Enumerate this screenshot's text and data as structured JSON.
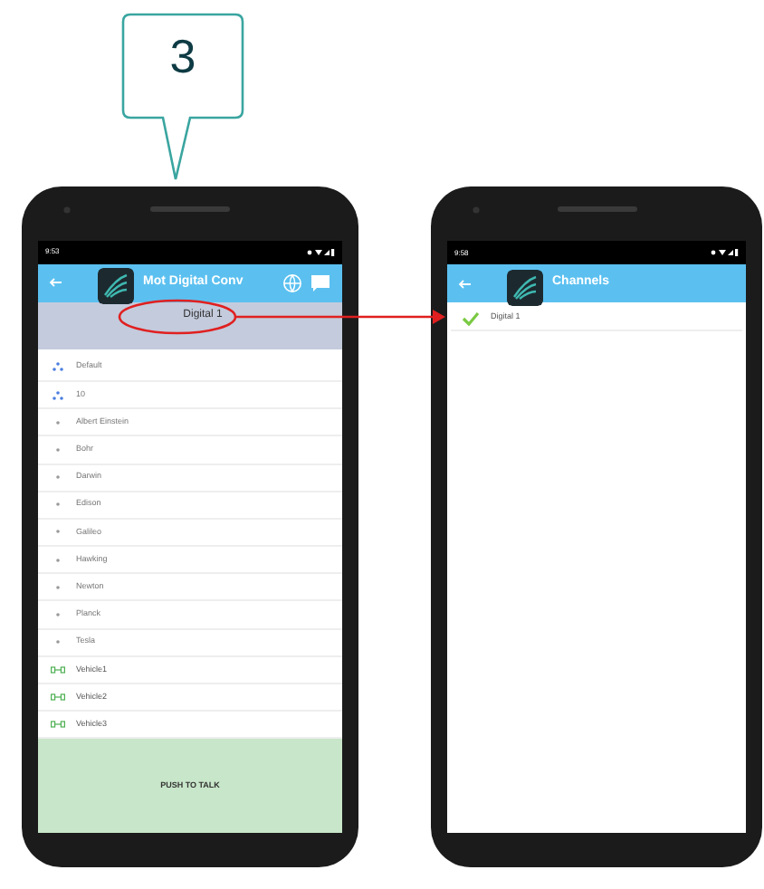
{
  "callout": {
    "label": "3"
  },
  "phones": [
    {
      "kind": "talkgroups",
      "time": "9:53",
      "title": "Mot Digital Conv",
      "selected_channel": "Digital 1",
      "items": [
        {
          "kind": "group",
          "label": "Default"
        },
        {
          "kind": "group",
          "label": "10"
        },
        {
          "kind": "contact",
          "label": "Albert Einstein"
        },
        {
          "kind": "contact",
          "label": "Bohr"
        },
        {
          "kind": "contact",
          "label": "Darwin"
        },
        {
          "kind": "contact",
          "label": "Edison"
        },
        {
          "kind": "contact",
          "label": "Galileo"
        },
        {
          "kind": "contact",
          "label": "Hawking"
        },
        {
          "kind": "contact",
          "label": "Newton"
        },
        {
          "kind": "contact",
          "label": "Planck"
        },
        {
          "kind": "contact",
          "label": "Tesla"
        },
        {
          "kind": "vehicle",
          "label": "Vehicle1"
        },
        {
          "kind": "vehicle",
          "label": "Vehicle2"
        },
        {
          "kind": "vehicle",
          "label": "Vehicle3"
        }
      ],
      "push_to_talk": "PUSH TO TALK"
    },
    {
      "kind": "channels",
      "time": "9:58",
      "title": "Channels",
      "items": [
        {
          "label": "Digital 1",
          "selected": true
        }
      ]
    }
  ]
}
